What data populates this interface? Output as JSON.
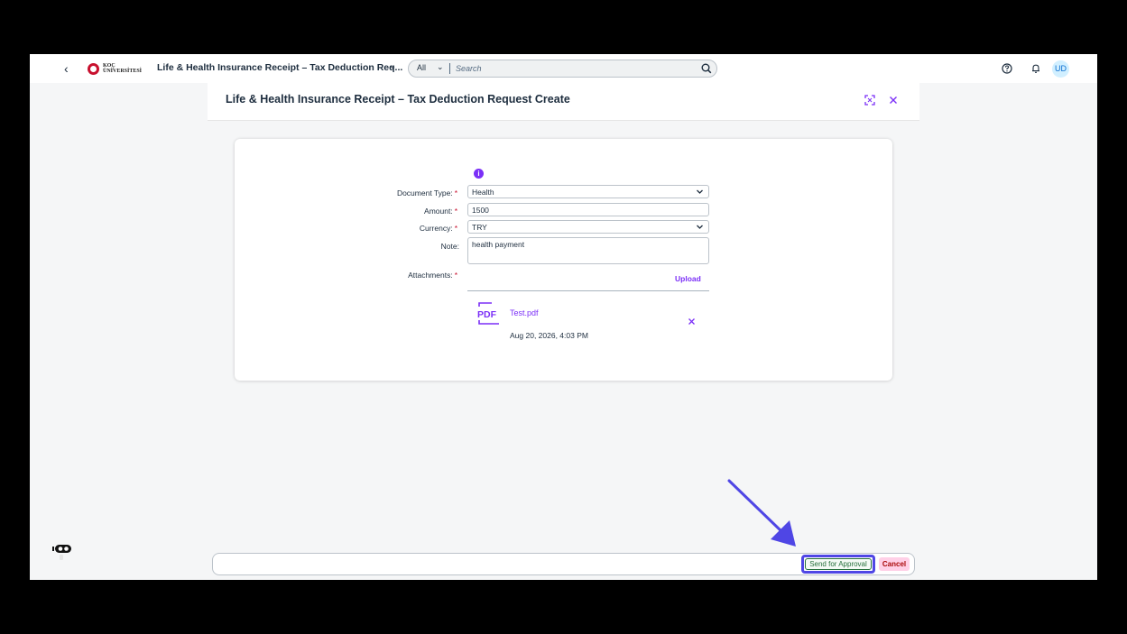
{
  "shell": {
    "logo_text_line1": "KOÇ",
    "logo_text_line2": "ÜNİVERSİTESİ",
    "app_title": "Life & Health Insurance Receipt – Tax Deduction Req...",
    "search_scope": "All",
    "search_placeholder": "Search",
    "avatar_initials": "UD"
  },
  "dialog": {
    "title": "Life & Health Insurance Receipt – Tax Deduction Request Create",
    "form": {
      "document_type_label": "Document Type:",
      "document_type_value": "Health",
      "amount_label": "Amount:",
      "amount_value": "1500",
      "currency_label": "Currency:",
      "currency_value": "TRY",
      "note_label": "Note:",
      "note_value": "health payment",
      "attachments_label": "Attachments:",
      "required_marker": "*",
      "upload_label": "Upload"
    },
    "attachment": {
      "file_name": "Test.pdf",
      "uploaded_at": "Aug 20, 2026, 4:03 PM"
    },
    "footer": {
      "send_label": "Send for Approval",
      "cancel_label": "Cancel"
    }
  },
  "colors": {
    "accent": "#7b2ff7",
    "highlight": "#4f46e5",
    "approve": "#256f3a",
    "cancel": "#aa0808"
  }
}
